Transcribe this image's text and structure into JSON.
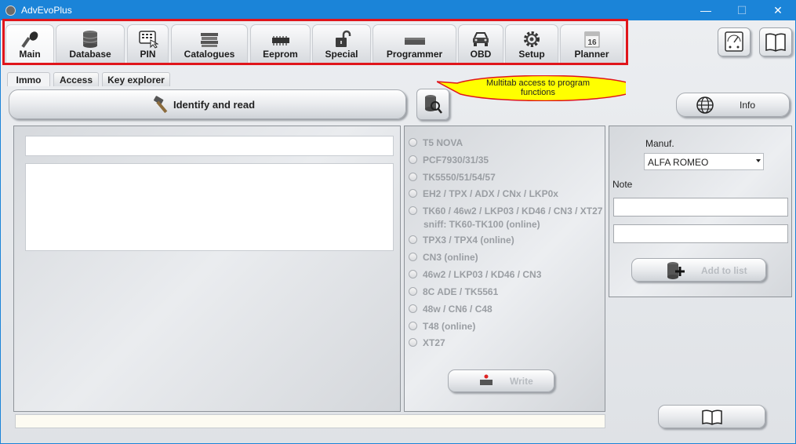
{
  "window": {
    "title": "AdvEvoPlus",
    "controls": {
      "minimize": "—",
      "maximize": "☐",
      "close": "✕"
    }
  },
  "main_tabs": [
    {
      "label": "Main",
      "icon": "key-icon"
    },
    {
      "label": "Database",
      "icon": "database-icon"
    },
    {
      "label": "PIN",
      "icon": "keypad-icon"
    },
    {
      "label": "Catalogues",
      "icon": "catalogue-icon"
    },
    {
      "label": "Eeprom",
      "icon": "eeprom-chip-icon"
    },
    {
      "label": "Special",
      "icon": "padlock-icon"
    },
    {
      "label": "Programmer",
      "icon": "programmer-icon"
    },
    {
      "label": "OBD",
      "icon": "car-icon"
    },
    {
      "label": "Setup",
      "icon": "gear-icon"
    },
    {
      "label": "Planner",
      "icon": "calendar-icon",
      "calendar_day": "16"
    }
  ],
  "sub_tabs": [
    "Immo",
    "Access",
    "Key explorer"
  ],
  "callout": {
    "text": "Multitab access to program functions"
  },
  "identify_button": {
    "label": "Identify and read"
  },
  "info_button": {
    "label": "Info"
  },
  "transponders": [
    "T5 NOVA",
    "PCF7930/31/35",
    "TK5550/51/54/57",
    "EH2 / TPX / ADX / CNx / LKP0x",
    "TK60 / 46w2 / LKP03 / KD46 / CN3 / XT27",
    "TPX3 / TPX4 (online)",
    "CN3 (online)",
    "46w2 / LKP03 / KD46 / CN3",
    "8C ADE / TK5561",
    "48w / CN6 / C48",
    "T48 (online)",
    "XT27"
  ],
  "transponder_note": "sniff: TK60-TK100 (online)",
  "write_button": {
    "label": "Write"
  },
  "right_panel": {
    "manuf_label": "Manuf.",
    "manuf_value": "ALFA ROMEO",
    "note_label": "Note",
    "add_button": "Add to list"
  },
  "colors": {
    "titlebar": "#1b84d8",
    "highlight_frame": "#e0151b",
    "callout_fill": "#ffff00"
  }
}
